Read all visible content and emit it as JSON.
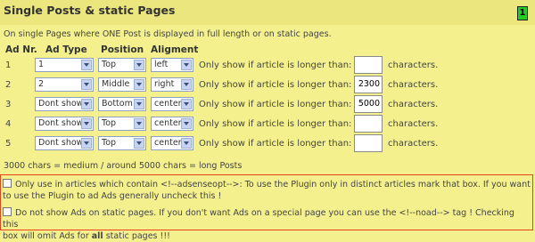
{
  "header": {
    "title": "Single Posts & static Pages",
    "badge": "1"
  },
  "description": "On single Pages where ONE Post is displayed in full length or on static pages.",
  "columns": {
    "nr": "Ad Nr.",
    "type": "Ad Type",
    "position": "Position",
    "alignment": "Aligment"
  },
  "row_text": {
    "only_show": "Only show if article is longer than:",
    "characters": "characters."
  },
  "rows": [
    {
      "nr": "1",
      "type": "1",
      "position": "Top",
      "align": "left",
      "length": ""
    },
    {
      "nr": "2",
      "type": "2",
      "position": "Middle",
      "align": "right",
      "length": "2300"
    },
    {
      "nr": "3",
      "type": "Dont show",
      "position": "Bottom",
      "align": "center",
      "length": "5000"
    },
    {
      "nr": "4",
      "type": "Dont show",
      "position": "Top",
      "align": "center",
      "length": ""
    },
    {
      "nr": "5",
      "type": "Dont show",
      "position": "Top",
      "align": "center",
      "length": ""
    }
  ],
  "length_note": "3000 chars = medium / around 5000 chars = long Posts",
  "options": {
    "opt1_line1": "Only use in articles which contain <!--adsenseopt-->: To use the Plugin only in distinct articles mark that box. If you want",
    "opt1_line2": "to use the Plugin to ad Ads generally uncheck this !",
    "opt2_line1": "Do not show Ads on static pages. If you don't want Ads on a special page you can use the <!--noad--> tag ! Checking this",
    "opt2_line2_pre": "box will omit Ads for ",
    "opt2_line2_bold": "all",
    "opt2_line2_post": " static pages !!!"
  },
  "colors": {
    "background": "#f4f08e",
    "header": "#ece67e",
    "badge": "#22cc22",
    "highlight_border": "#e8431a"
  }
}
